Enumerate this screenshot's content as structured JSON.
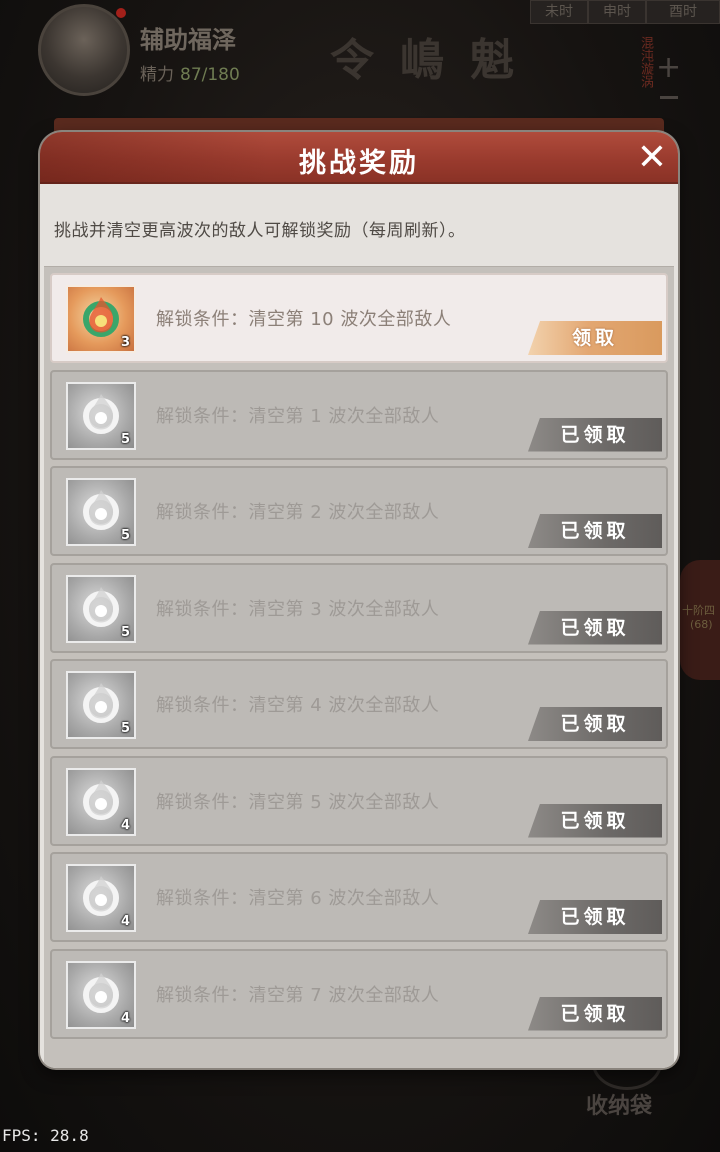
{
  "hud": {
    "player_name": "辅助福泽",
    "stamina_label": "精力",
    "stamina_value": "87/180",
    "time_tabs": [
      "未时",
      "申时",
      "酉时"
    ],
    "side_vertical_text": "混沌漩涡",
    "side_badge_text": "十阶四",
    "side_badge_num": "(68)",
    "storage_label": "收纳袋",
    "hud_glyphs": [
      "令",
      "嶋",
      "魁"
    ]
  },
  "fps": "FPS: 28.8",
  "modal": {
    "title": "挑战奖励",
    "close_icon": "✕",
    "intro": "挑战并清空更高波次的敌人可解锁奖励（每周刷新）。"
  },
  "rewards": [
    {
      "condition": "解锁条件：清空第 10 波次全部敌人",
      "count": "3",
      "button": "领取",
      "state": "active"
    },
    {
      "condition": "解锁条件：清空第 1 波次全部敌人",
      "count": "5",
      "button": "已领取",
      "state": "claimed"
    },
    {
      "condition": "解锁条件：清空第 2 波次全部敌人",
      "count": "5",
      "button": "已领取",
      "state": "claimed"
    },
    {
      "condition": "解锁条件：清空第 3 波次全部敌人",
      "count": "5",
      "button": "已领取",
      "state": "claimed"
    },
    {
      "condition": "解锁条件：清空第 4 波次全部敌人",
      "count": "5",
      "button": "已领取",
      "state": "claimed"
    },
    {
      "condition": "解锁条件：清空第 5 波次全部敌人",
      "count": "4",
      "button": "已领取",
      "state": "claimed"
    },
    {
      "condition": "解锁条件：清空第 6 波次全部敌人",
      "count": "4",
      "button": "已领取",
      "state": "claimed"
    },
    {
      "condition": "解锁条件：清空第 7 波次全部敌人",
      "count": "4",
      "button": "已领取",
      "state": "claimed"
    }
  ],
  "colors": {
    "header_red": "#9a3b2e",
    "claim_orange": "#e3a772",
    "claimed_gray": "#6c6967"
  }
}
